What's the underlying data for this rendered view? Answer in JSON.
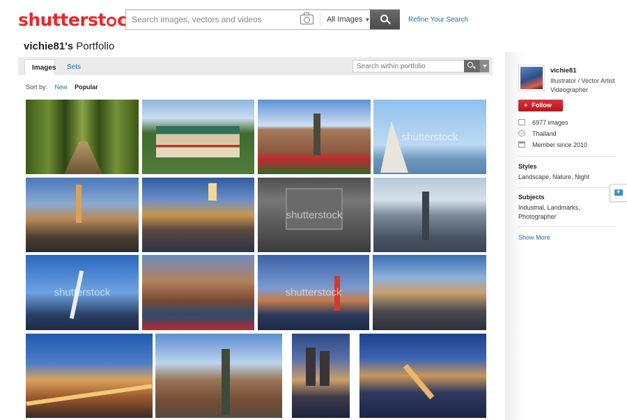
{
  "header": {
    "logo_part1": "shutterst",
    "logo_part2": "ck",
    "search_placeholder": "Search images, vectors and videos",
    "media_select": "All Images",
    "refine_link": "Refine Your Search"
  },
  "portfolio": {
    "owner": "vichie81's",
    "title_suffix": " Portfolio",
    "tabs": [
      {
        "label": "Images",
        "active": true
      },
      {
        "label": "Sets",
        "active": false
      }
    ],
    "search_placeholder": "Search within portfolio",
    "sort_label": "Sort by:",
    "sort_new": "New",
    "sort_popular": "Popular",
    "watermark": "shutterstock"
  },
  "thumbnails": [
    {
      "subject": "bamboo forest path",
      "watermark": false
    },
    {
      "subject": "chinese temple",
      "watermark": false
    },
    {
      "subject": "frankfurt square fountain",
      "watermark": false
    },
    {
      "subject": "lisbon monument",
      "watermark": true
    },
    {
      "subject": "antwerp city night",
      "watermark": false
    },
    {
      "subject": "marseille harbor",
      "watermark": false
    },
    {
      "subject": "parking garage",
      "watermark": true
    },
    {
      "subject": "chicago skyline",
      "watermark": false
    },
    {
      "subject": "rotterdam bridge",
      "watermark": true
    },
    {
      "subject": "colmar canal",
      "watermark": false
    },
    {
      "subject": "kobe port tower",
      "watermark": true
    },
    {
      "subject": "new york skyline",
      "watermark": false
    },
    {
      "subject": "madrid gran via",
      "watermark": false
    },
    {
      "subject": "frankfurt statue",
      "watermark": false
    },
    {
      "subject": "cologne cathedral",
      "watermark": false
    },
    {
      "subject": "prague charles bridge",
      "watermark": false
    }
  ],
  "profile": {
    "username": "vichie81",
    "role_line1": "Illustrator / Vector Artist",
    "role_line2": "Videographer",
    "follow_label": "Follow",
    "images_count": "6977 images",
    "location": "Thailand",
    "member_since": "Member since 2010",
    "styles_heading": "Styles",
    "styles": "Landscape, Nature, Night",
    "subjects_heading": "Subjects",
    "subjects": "Industrial, Landmarks, Photographer",
    "show_more": "Show More"
  },
  "colors": {
    "brand_red": "#e8272a",
    "link_blue": "#1f6fa3",
    "follow_red": "#c8222a"
  }
}
